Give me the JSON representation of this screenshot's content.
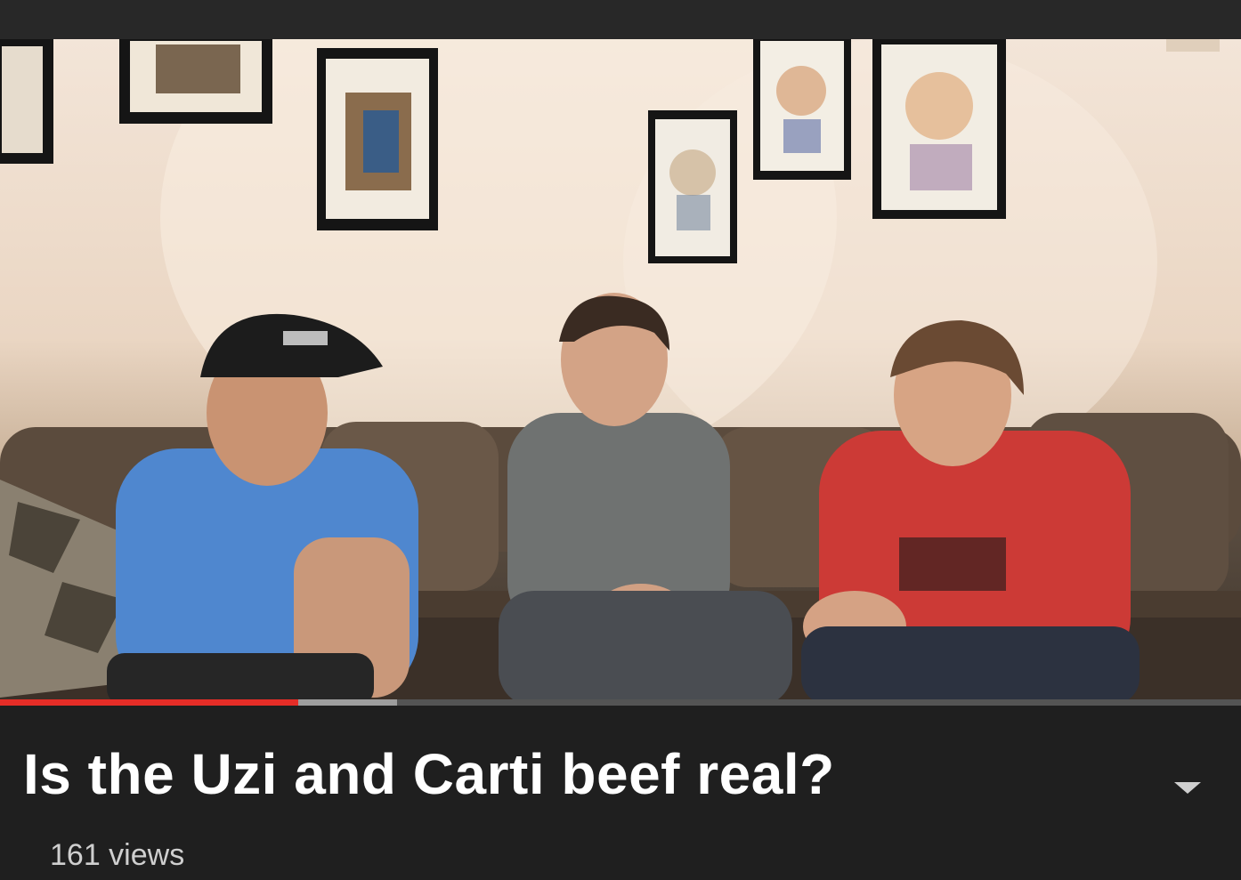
{
  "video": {
    "title": "Is the Uzi and Carti beef real?",
    "views": "161 views",
    "progress_played": 0.24,
    "progress_buffered": 0.32
  },
  "icons": {
    "expand": "chevron-down-icon"
  },
  "colors": {
    "background": "#212121",
    "progress_played": "#e52d27",
    "progress_buffered": "#9e9e9e",
    "title_text": "#ffffff",
    "meta_text": "#cfcfcf"
  }
}
